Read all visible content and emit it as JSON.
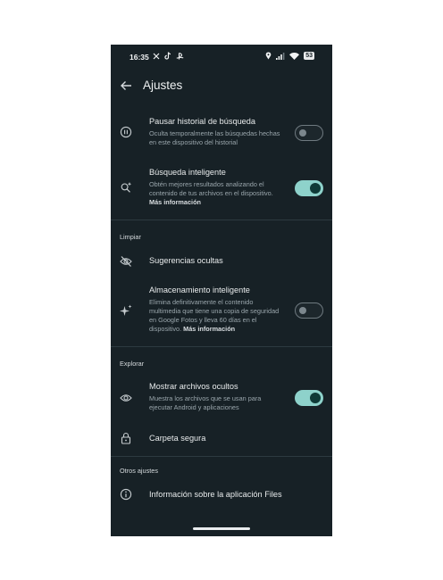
{
  "status_bar": {
    "time": "16:35",
    "battery": "53",
    "app_icons": [
      "x-icon",
      "tiktok-icon",
      "playstation-icon"
    ],
    "system_icons": [
      "location-icon",
      "signal-icon",
      "wifi-icon",
      "battery-icon"
    ]
  },
  "appbar": {
    "title": "Ajustes"
  },
  "items": {
    "pause_history": {
      "title": "Pausar historial de búsqueda",
      "subtitle": "Oculta temporalmente las búsquedas hechas en este dispositivo del historial",
      "enabled": false
    },
    "smart_search": {
      "title": "Búsqueda inteligente",
      "subtitle": "Obtén mejores resultados analizando el contenido de tus archivos en el dispositivo.",
      "link": "Más información",
      "enabled": true
    },
    "hidden_suggestions": {
      "title": "Sugerencias ocultas"
    },
    "smart_storage": {
      "title": "Almacenamiento inteligente",
      "subtitle": "Elimina definitivamente el contenido multimedia que tiene una copia de seguridad en Google Fotos y lleva 60 días en el dispositivo.",
      "link": "Más información",
      "enabled": false
    },
    "show_hidden": {
      "title": "Mostrar archivos ocultos",
      "subtitle": "Muestra los archivos que se usan para ejecutar Android y aplicaciones",
      "enabled": true
    },
    "safe_folder": {
      "title": "Carpeta segura"
    },
    "app_info": {
      "title": "Información sobre la aplicación Files"
    }
  },
  "sections": {
    "clean": "Limpiar",
    "explore": "Explorar",
    "other": "Otros ajustes"
  },
  "colors": {
    "background": "#172126",
    "switch_on_track": "#8ed2cb",
    "switch_on_knob": "#0f3a37",
    "text_primary": "#e8ebec",
    "text_secondary": "#9aa6ac"
  }
}
